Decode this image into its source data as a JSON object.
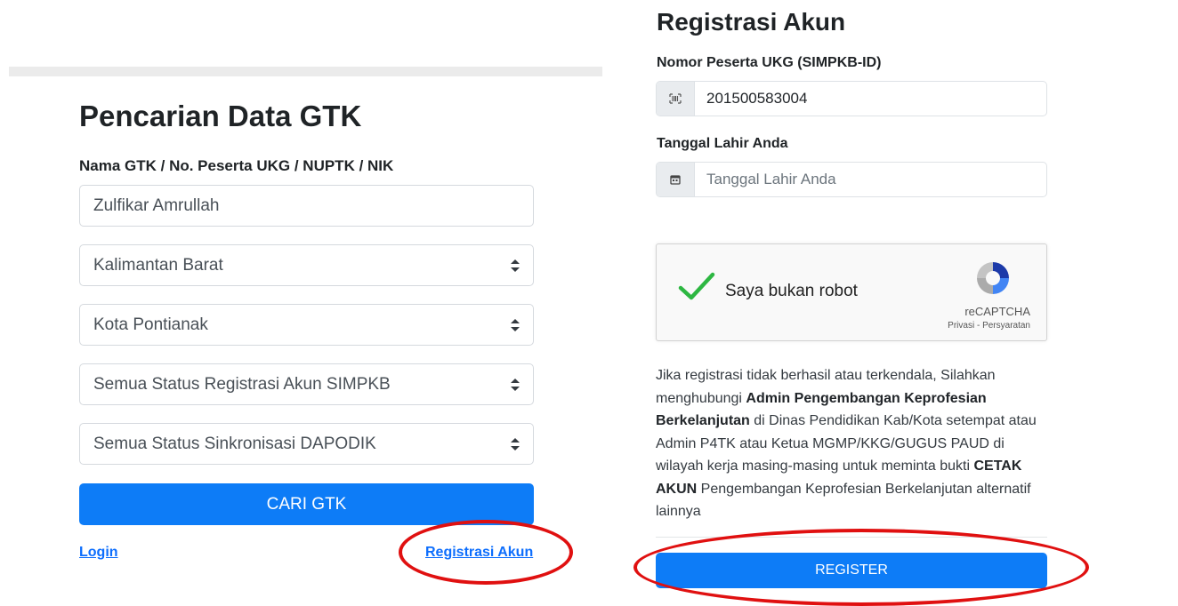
{
  "search": {
    "title": "Pencarian Data GTK",
    "field_label": "Nama GTK / No. Peserta UKG / NUPTK / NIK",
    "name_value": "Zulfikar Amrullah",
    "province": "Kalimantan Barat",
    "city": "Kota Pontianak",
    "registration_status": "Semua Status Registrasi Akun SIMPKB",
    "sync_status": "Semua Status Sinkronisasi DAPODIK",
    "search_button": "CARI GTK",
    "login_link": "Login",
    "register_link": "Registrasi Akun"
  },
  "register": {
    "title": "Registrasi Akun",
    "id_label": "Nomor Peserta UKG (SIMPKB-ID)",
    "id_value": "201500583004",
    "id_icon": "barcode-icon",
    "dob_label": "Tanggal Lahir Anda",
    "dob_placeholder": "Tanggal Lahir Anda",
    "dob_icon": "calendar-icon",
    "captcha": {
      "text": "Saya bukan robot",
      "brand": "reCAPTCHA",
      "privacy": "Privasi",
      "separator": " - ",
      "terms": "Persyaratan"
    },
    "description": {
      "p1": "Jika registrasi tidak berhasil atau terkendala, Silahkan menghubungi ",
      "b1": "Admin Pengembangan Keprofesian Berkelanjutan",
      "p2": " di Dinas Pendidikan Kab/Kota setempat atau Admin P4TK atau Ketua MGMP/KKG/GUGUS PAUD di wilayah kerja masing-masing untuk meminta bukti ",
      "b2": "CETAK AKUN",
      "p3": " Pengembangan Keprofesian Berkelanjutan alternatif lainnya"
    },
    "register_button": "REGISTER"
  },
  "colors": {
    "primary": "#0d7cf7",
    "link": "#0d6efd",
    "highlight": "#e01010",
    "check": "#2db742"
  }
}
